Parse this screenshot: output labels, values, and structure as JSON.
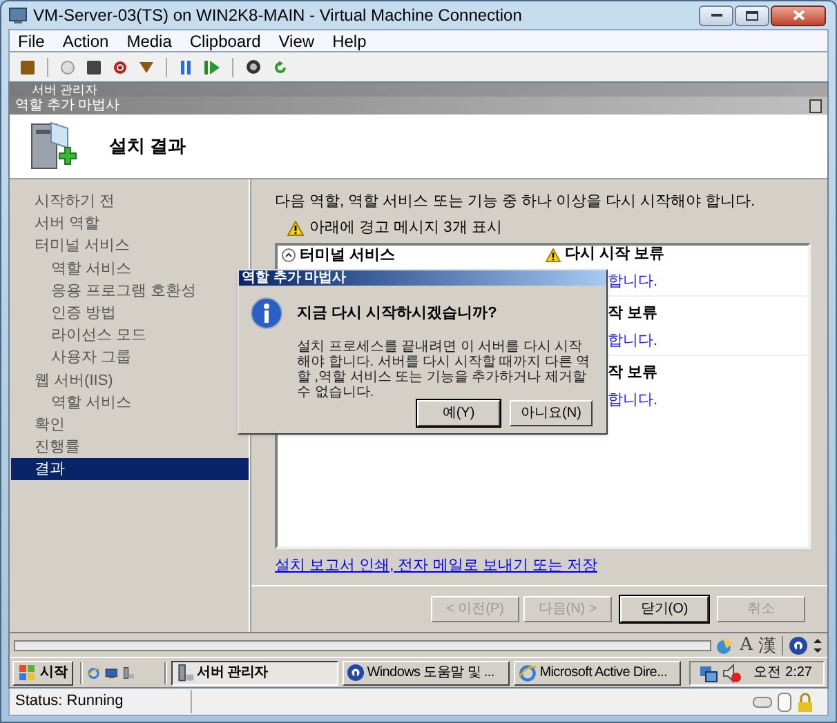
{
  "window": {
    "title": "VM-Server-03(TS) on WIN2K8-MAIN - Virtual Machine Connection"
  },
  "menu": [
    "File",
    "Action",
    "Media",
    "Clipboard",
    "View",
    "Help"
  ],
  "server_manager": {
    "title": "서버 관리자"
  },
  "wizard": {
    "title": "역할 추가 마법사",
    "page_title": "설치 결과",
    "nav": [
      {
        "label": "시작하기 전",
        "selected": false
      },
      {
        "label": "서버 역할",
        "selected": false
      },
      {
        "label": "터미널 서비스",
        "selected": false,
        "children": [
          {
            "label": "역할 서비스",
            "selected": false
          },
          {
            "label": "응용 프로그램 호환성",
            "selected": false
          },
          {
            "label": "인증 방법",
            "selected": false
          },
          {
            "label": "라이선스 모드",
            "selected": false
          },
          {
            "label": "사용자 그룹",
            "selected": false
          }
        ]
      },
      {
        "label": "웹 서버(IIS)",
        "selected": false,
        "children": [
          {
            "label": "역할 서비스",
            "selected": false
          }
        ]
      },
      {
        "label": "확인",
        "selected": false
      },
      {
        "label": "진행률",
        "selected": false
      },
      {
        "label": "결과",
        "selected": true
      }
    ],
    "intro": "다음 역할, 역할 서비스 또는 기능 중 하나 이상을 다시 시작해야 합니다.",
    "warning_summary": "아래에 경고 메시지 3개 표시",
    "results": [
      {
        "name": "터미널 서비스",
        "status": "다시 시작 보류",
        "detail": "합니다."
      },
      {
        "status": "작 보류",
        "detail": "합니다."
      },
      {
        "status": "작 보류",
        "detail": "합니다."
      }
    ],
    "report_link": "설치 보고서 인쇄, 전자 메일로 보내기 또는 저장",
    "buttons": [
      {
        "label": "< 이전(P)",
        "disabled": true,
        "selected": false
      },
      {
        "label": "다음(N) >",
        "disabled": true,
        "selected": false
      },
      {
        "label": "닫기(O)",
        "disabled": false,
        "selected": true
      },
      {
        "label": "취소",
        "disabled": true,
        "selected": false
      }
    ]
  },
  "dialog": {
    "title": "역할 추가 마법사",
    "question": "지금 다시 시작하시겠습니까?",
    "message": "설치 프로세스를 끝내려면 이 서버를 다시 시작해야 합니다. 서버를 다시 시작할 때까지 다른 역할 ,역할 서비스 또는 기능을 추가하거나 제거할 수 없습니다.",
    "buttons": [
      {
        "label": "예(Y)",
        "selected": true
      },
      {
        "label": "아니요(N)",
        "selected": false
      }
    ]
  },
  "language_bar": {
    "input_mode": "A",
    "hanja": "漢"
  },
  "taskbar": {
    "start": "시작",
    "tasks": [
      {
        "label": "서버 관리자",
        "selected": true
      },
      {
        "label": "Windows 도움말 및 ...",
        "selected": false
      },
      {
        "label": "Microsoft Active Dire...",
        "selected": false
      }
    ],
    "clock": "오전 2:27"
  },
  "status_bar": {
    "text": "Status: Running"
  }
}
